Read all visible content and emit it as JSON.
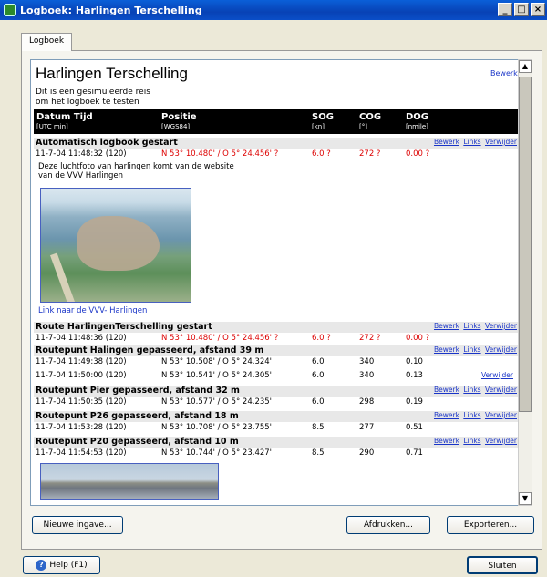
{
  "window": {
    "title": "Logboek: Harlingen Terschelling",
    "controls": [
      "_",
      "□",
      "×"
    ]
  },
  "tab": {
    "label": "Logboek"
  },
  "trip": {
    "title": "Harlingen Terschelling",
    "description_line1": "Dit is een gesimuleerde reis",
    "description_line2": "om het logboek te testen",
    "edit_label": "Bewerk"
  },
  "columns": {
    "datetime": {
      "label": "Datum Tijd",
      "unit": "[UTC min]"
    },
    "position": {
      "label": "Positie",
      "unit": "[WGS84]"
    },
    "sog": {
      "label": "SOG",
      "unit": "[kn]"
    },
    "cog": {
      "label": "COG",
      "unit": "[°]"
    },
    "dog": {
      "label": "DOG",
      "unit": "[nmile]"
    }
  },
  "actions": {
    "edit": "Bewerk",
    "links": "Links",
    "delete": "Verwijder"
  },
  "entries": [
    {
      "title": "Automatisch logbook gestart",
      "datetime": "11-7-04 11:48:32 (120)",
      "position": "N 53° 10.480' / O 5° 24.456' ?",
      "sog": "6.0 ?",
      "cog": "272 ?",
      "dog": "0.00 ?",
      "note_line1": "Deze luchtfoto van harlingen komt van de website",
      "note_line2": "van de VVV Harlingen",
      "link": "Link naar de VVV- Harlingen"
    },
    {
      "title": "Route HarlingenTerschelling gestart",
      "datetime": "11-7-04 11:48:36 (120)",
      "position": "N 53° 10.480' / O 5° 24.456' ?",
      "sog": "6.0 ?",
      "cog": "272 ?",
      "dog": "0.00 ?"
    },
    {
      "title": "Routepunt Halingen gepasseerd, afstand 39 m",
      "datetime": "11-7-04 11:49:38 (120)",
      "position": "N 53° 10.508' / O 5° 24.324'",
      "sog": "6.0",
      "cog": "340",
      "dog": "0.10"
    },
    {
      "datetime": "11-7-04 11:50:00 (120)",
      "position": "N 53° 10.541' / O 5° 24.305'",
      "sog": "6.0",
      "cog": "340",
      "dog": "0.13"
    },
    {
      "title": "Routepunt Pier gepasseerd, afstand 32 m",
      "datetime": "11-7-04 11:50:35 (120)",
      "position": "N 53° 10.577' / O 5° 24.235'",
      "sog": "6.0",
      "cog": "298",
      "dog": "0.19"
    },
    {
      "title": "Routepunt P26 gepasseerd, afstand 18 m",
      "datetime": "11-7-04 11:53:28 (120)",
      "position": "N 53° 10.708' / O 5° 23.755'",
      "sog": "8.5",
      "cog": "277",
      "dog": "0.51"
    },
    {
      "title": "Routepunt P20 gepasseerd, afstand 10 m",
      "datetime": "11-7-04 11:54:53 (120)",
      "position": "N 53° 10.744' / O 5° 23.427'",
      "sog": "8.5",
      "cog": "290",
      "dog": "0.71"
    }
  ],
  "buttons": {
    "new_entry": "Nieuwe ingave...",
    "print": "Afdrukken...",
    "export": "Exporteren...",
    "help": "Help (F1)",
    "close": "Sluiten"
  }
}
